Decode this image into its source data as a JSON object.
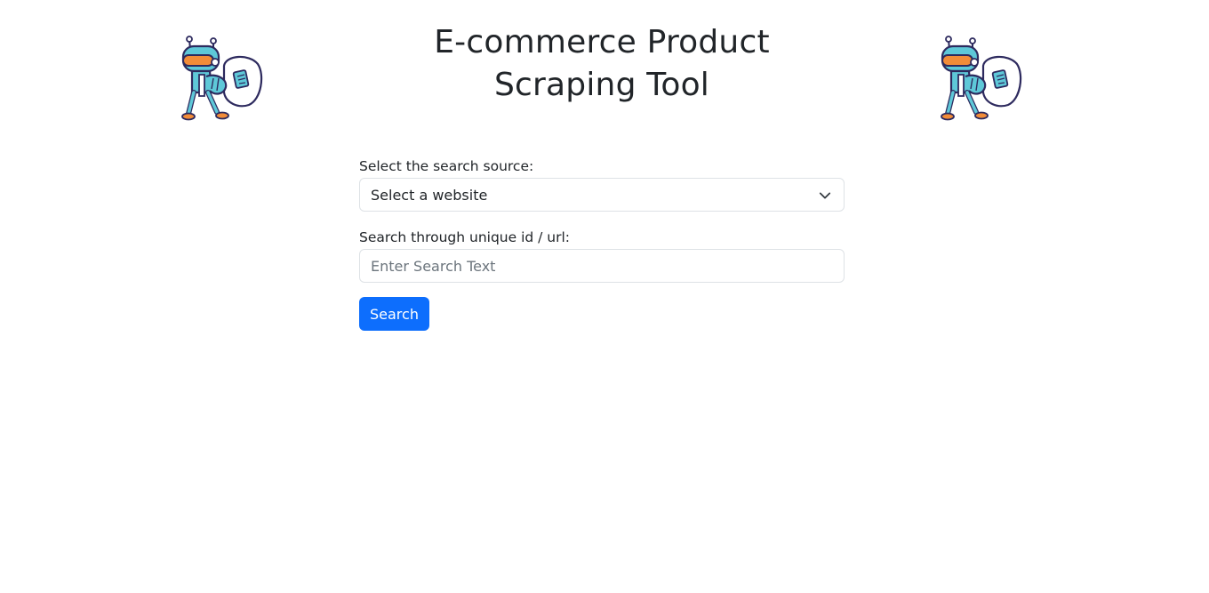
{
  "header": {
    "title": "E-commerce Product Scraping Tool",
    "mascot_icon": "robot-with-sack-icon"
  },
  "form": {
    "source_label": "Select the search source:",
    "source_select_value": "Select a website",
    "search_label": "Search through unique id / url:",
    "search_placeholder": "Enter Search Text",
    "search_value": "",
    "submit_label": "Search"
  },
  "colors": {
    "primary": "#0d6efd",
    "text": "#212529",
    "border": "#dee2e6",
    "robot_teal": "#5ec8d8",
    "robot_orange": "#f28c38",
    "robot_outline": "#2d2a5e"
  }
}
